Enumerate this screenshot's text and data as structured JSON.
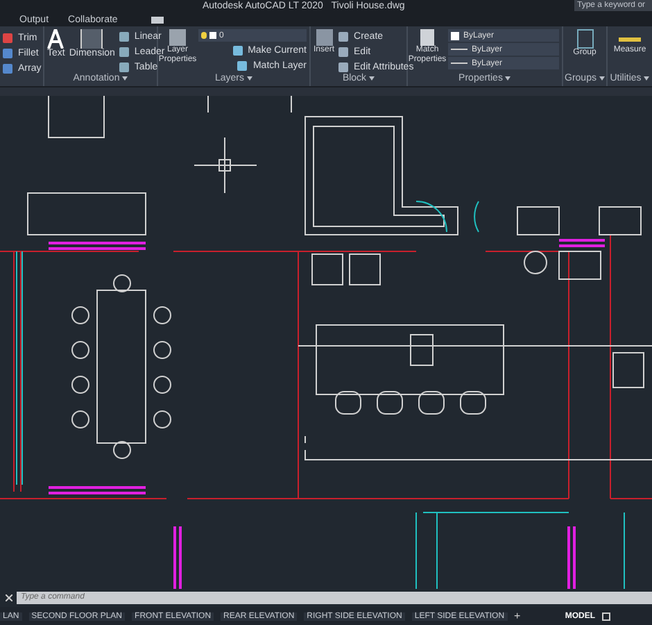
{
  "window": {
    "app_title": "Autodesk AutoCAD LT 2020",
    "file_title": "Tivoli House.dwg"
  },
  "search": {
    "placeholder": "Type a keyword or"
  },
  "ribbon_tabs": [
    {
      "label": "Output",
      "selected": false
    },
    {
      "label": "Collaborate",
      "selected": false
    }
  ],
  "modify_panel": {
    "items": [
      "Trim",
      "Fillet",
      "Array"
    ]
  },
  "annotation_panel": {
    "title": "Annotation",
    "large": [
      "Text",
      "Dimension"
    ],
    "small": [
      "Linear",
      "Leader",
      "Table"
    ]
  },
  "layers_panel": {
    "title": "Layers",
    "large": "Layer Properties",
    "layer_value": "0",
    "small": [
      "Make Current",
      "Match Layer"
    ]
  },
  "block_panel": {
    "title": "Block",
    "large": "Insert",
    "small": [
      "Create",
      "Edit",
      "Edit Attributes"
    ]
  },
  "properties_panel": {
    "title": "Properties",
    "large": "Match Properties",
    "dropdowns": [
      "ByLayer",
      "ByLayer",
      "ByLayer"
    ]
  },
  "groups_panel": {
    "title": "Groups",
    "large": "Group"
  },
  "utilities_panel": {
    "title": "Utilities",
    "large": "Measure"
  },
  "command_line": {
    "placeholder": "Type a command"
  },
  "layout_tabs": [
    {
      "label": "LAN",
      "selected": false
    },
    {
      "label": "SECOND FLOOR PLAN",
      "selected": false
    },
    {
      "label": "FRONT ELEVATION",
      "selected": false
    },
    {
      "label": "REAR ELEVATION",
      "selected": false
    },
    {
      "label": "RIGHT SIDE ELEVATION",
      "selected": false
    },
    {
      "label": "LEFT SIDE ELEVATION",
      "selected": false
    }
  ],
  "add_tab": "+",
  "status_bar": {
    "space": "MODEL"
  }
}
